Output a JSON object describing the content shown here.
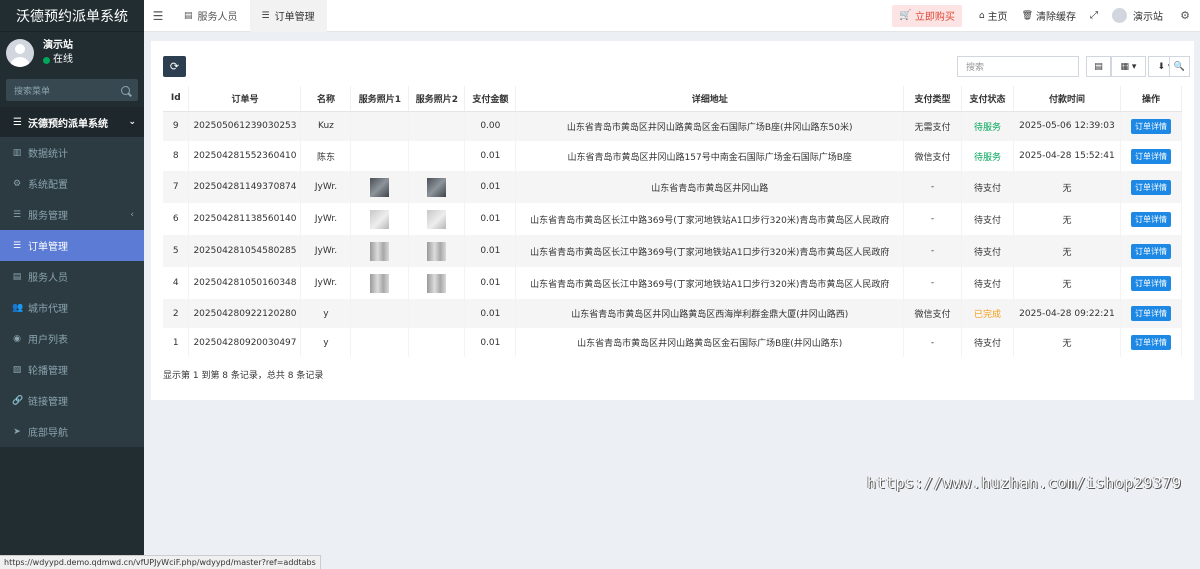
{
  "app": {
    "title": "沃德预约派单系统"
  },
  "user": {
    "name": "演示站",
    "status": "在线"
  },
  "sidebar": {
    "search_placeholder": "搜索菜单",
    "group_label": "沃德预约派单系统",
    "items": [
      {
        "label": "数据统计",
        "icon": "chart-icon"
      },
      {
        "label": "系统配置",
        "icon": "gear-icon"
      },
      {
        "label": "服务管理",
        "icon": "list-icon"
      },
      {
        "label": "订单管理",
        "icon": "list-icon"
      },
      {
        "label": "服务人员",
        "icon": "idcard-icon"
      },
      {
        "label": "城市代理",
        "icon": "users-icon"
      },
      {
        "label": "用户列表",
        "icon": "user-circle-icon"
      },
      {
        "label": "轮播管理",
        "icon": "image-icon"
      },
      {
        "label": "链接管理",
        "icon": "link-icon"
      },
      {
        "label": "底部导航",
        "icon": "send-icon"
      }
    ]
  },
  "topbar": {
    "tabs": [
      {
        "label": "服务人员"
      },
      {
        "label": "订单管理"
      }
    ],
    "buy_label": "立即购买",
    "home_label": "主页",
    "clear_cache_label": "清除缓存",
    "user_label": "演示站"
  },
  "toolbar": {
    "search_placeholder": "搜索"
  },
  "table": {
    "headers": [
      "Id",
      "订单号",
      "名称",
      "服务照片1",
      "服务照片2",
      "支付金额",
      "详细地址",
      "支付类型",
      "支付状态",
      "付款时间",
      "操作"
    ],
    "rows": [
      {
        "id": "9",
        "order_no": "202505061239030253",
        "name": "Kuz",
        "photo1": "",
        "photo2": "",
        "amount": "0.00",
        "address": "山东省青岛市黄岛区井冈山路黄岛区金石国际广场B座(井冈山路东50米)",
        "pay_type": "无需支付",
        "pay_status": "待服务",
        "status_color": "#00a65a",
        "pay_time": "2025-05-06 12:39:03",
        "action": "订单详情"
      },
      {
        "id": "8",
        "order_no": "202504281552360410",
        "name": "陈东",
        "photo1": "",
        "photo2": "",
        "amount": "0.01",
        "address": "山东省青岛市黄岛区井冈山路157号中南金石国际广场金石国际广场B座",
        "pay_type": "微信支付",
        "pay_status": "待服务",
        "status_color": "#00a65a",
        "pay_time": "2025-04-28 15:52:41",
        "action": "订单详情"
      },
      {
        "id": "7",
        "order_no": "202504281149370874",
        "name": "JyWr.",
        "photo1": "dark",
        "photo2": "dark",
        "amount": "0.01",
        "address": "山东省青岛市黄岛区井冈山路",
        "pay_type": "-",
        "pay_status": "待支付",
        "status_color": "#333333",
        "pay_time": "无",
        "action": "订单详情"
      },
      {
        "id": "6",
        "order_no": "202504281138560140",
        "name": "JyWr.",
        "photo1": "light",
        "photo2": "light",
        "amount": "0.01",
        "address": "山东省青岛市黄岛区长江中路369号(丁家河地铁站A1口步行320米)青岛市黄岛区人民政府",
        "pay_type": "-",
        "pay_status": "待支付",
        "status_color": "#333333",
        "pay_time": "无",
        "action": "订单详情"
      },
      {
        "id": "5",
        "order_no": "202504281054580285",
        "name": "JyWr.",
        "photo1": "mid",
        "photo2": "mid",
        "amount": "0.01",
        "address": "山东省青岛市黄岛区长江中路369号(丁家河地铁站A1口步行320米)青岛市黄岛区人民政府",
        "pay_type": "-",
        "pay_status": "待支付",
        "status_color": "#333333",
        "pay_time": "无",
        "action": "订单详情"
      },
      {
        "id": "4",
        "order_no": "202504281050160348",
        "name": "JyWr.",
        "photo1": "mid",
        "photo2": "mid",
        "amount": "0.01",
        "address": "山东省青岛市黄岛区长江中路369号(丁家河地铁站A1口步行320米)青岛市黄岛区人民政府",
        "pay_type": "-",
        "pay_status": "待支付",
        "status_color": "#333333",
        "pay_time": "无",
        "action": "订单详情"
      },
      {
        "id": "2",
        "order_no": "202504280922120280",
        "name": "y",
        "photo1": "",
        "photo2": "",
        "amount": "0.01",
        "address": "山东省青岛市黄岛区井冈山路黄岛区西海岸利群金鼎大厦(井冈山路西)",
        "pay_type": "微信支付",
        "pay_status": "已完成",
        "status_color": "#f39c12",
        "pay_time": "2025-04-28 09:22:21",
        "action": "订单详情"
      },
      {
        "id": "1",
        "order_no": "202504280920030497",
        "name": "y",
        "photo1": "",
        "photo2": "",
        "amount": "0.01",
        "address": "山东省青岛市黄岛区井冈山路黄岛区金石国际广场B座(井冈山路东)",
        "pay_type": "-",
        "pay_status": "待支付",
        "status_color": "#333333",
        "pay_time": "无",
        "action": "订单详情"
      }
    ]
  },
  "pagination_info": "显示第 1 到第 8 条记录，总共 8 条记录",
  "watermark": "https://www.huzhan.com/ishop29379",
  "status_url": "https://wdyypd.demo.qdmwd.cn/vfUPJyWciF.php/wdyypd/master?ref=addtabs"
}
